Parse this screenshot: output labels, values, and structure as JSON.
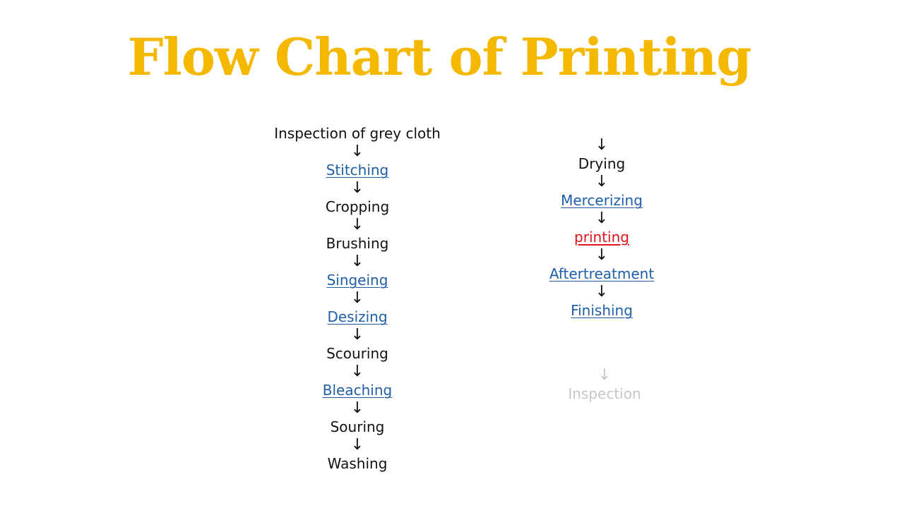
{
  "title": "Flow Chart of Printing",
  "colors": {
    "title": "#f5b800",
    "link": "#1f5fa8",
    "highlight": "#e0141c",
    "text": "#111111",
    "faded": "#c6c6c6"
  },
  "arrow_glyph": "↓",
  "left_column": [
    {
      "label": "Inspection of grey cloth",
      "style": "plain"
    },
    {
      "label": "Stitching",
      "style": "link"
    },
    {
      "label": "Cropping",
      "style": "plain"
    },
    {
      "label": "Brushing",
      "style": "plain"
    },
    {
      "label": "Singeing",
      "style": "link"
    },
    {
      "label": "Desizing",
      "style": "link"
    },
    {
      "label": "Scouring",
      "style": "plain"
    },
    {
      "label": "Bleaching",
      "style": "link"
    },
    {
      "label": "Souring",
      "style": "plain"
    },
    {
      "label": "Washing",
      "style": "plain"
    }
  ],
  "right_column": [
    {
      "label": "Drying",
      "style": "plain"
    },
    {
      "label": "Mercerizing",
      "style": "link"
    },
    {
      "label": "printing",
      "style": "red"
    },
    {
      "label": "Aftertreatment",
      "style": "link"
    },
    {
      "label": "Finishing",
      "style": "link"
    }
  ],
  "faded_step": {
    "label": "Inspection"
  }
}
